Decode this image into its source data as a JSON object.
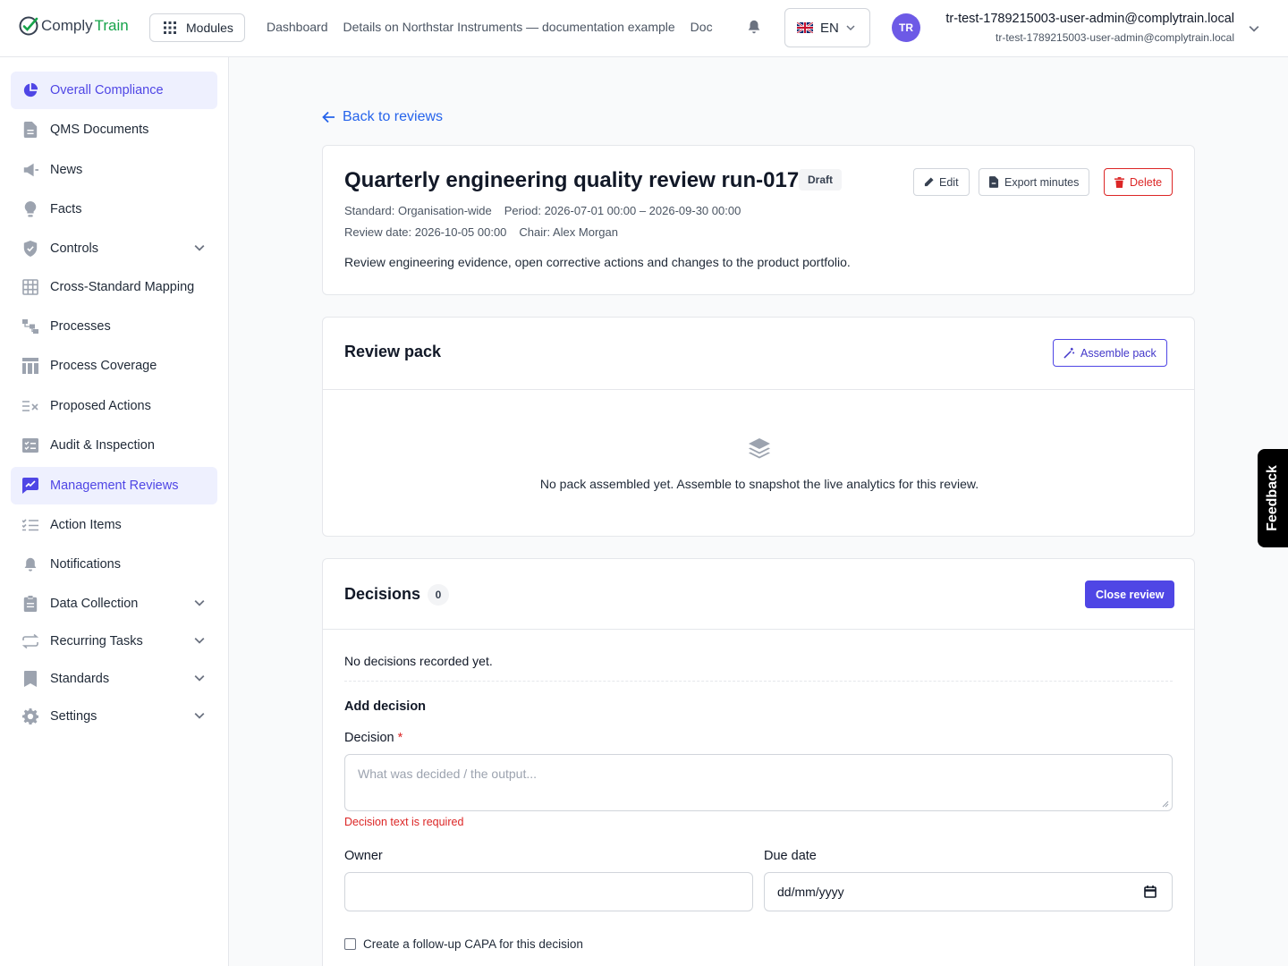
{
  "app": {
    "brand_part1": "Comply",
    "brand_part2": "Train",
    "modules_label": "Modules",
    "nav": [
      "Dashboard",
      "Details on Northstar Instruments — documentation example",
      "Doc"
    ],
    "language": "EN",
    "user": {
      "initials": "TR",
      "name": "tr-test-1789215003-user-admin@complytrain.local",
      "email": "tr-test-1789215003-user-admin@complytrain.local"
    },
    "feedback_label": "Feedback"
  },
  "sidebar": {
    "items": [
      {
        "label": "Overall Compliance",
        "icon": "pie-chart-icon",
        "active": true
      },
      {
        "label": "QMS Documents",
        "icon": "document-icon"
      },
      {
        "label": "News",
        "icon": "megaphone-icon"
      },
      {
        "label": "Facts",
        "icon": "lightbulb-icon"
      },
      {
        "label": "Controls",
        "icon": "shield-icon",
        "expandable": true
      },
      {
        "label": "Cross-Standard Mapping",
        "icon": "grid-icon"
      },
      {
        "label": "Processes",
        "icon": "hierarchy-icon"
      },
      {
        "label": "Process Coverage",
        "icon": "table-icon"
      },
      {
        "label": "Proposed Actions",
        "icon": "list-check-icon"
      },
      {
        "label": "Audit & Inspection",
        "icon": "checklist-icon"
      },
      {
        "label": "Management Reviews",
        "icon": "chart-box-icon",
        "active": true
      },
      {
        "label": "Action Items",
        "icon": "task-list-icon"
      },
      {
        "label": "Notifications",
        "icon": "bell-icon"
      },
      {
        "label": "Data Collection",
        "icon": "clipboard-icon",
        "expandable": true
      },
      {
        "label": "Recurring Tasks",
        "icon": "repeat-icon",
        "expandable": true
      },
      {
        "label": "Standards",
        "icon": "bookmark-icon",
        "expandable": true
      },
      {
        "label": "Settings",
        "icon": "gear-icon",
        "expandable": true
      }
    ]
  },
  "review": {
    "back_label": "Back to reviews",
    "title": "Quarterly engineering quality review run-017",
    "status": "Draft",
    "standard": "Standard: Organisation-wide",
    "period": "Period: 2026-07-01 00:00 – 2026-09-30 00:00",
    "review_date": "Review date: 2026-10-05 00:00",
    "chair": "Chair: Alex Morgan",
    "description": "Review engineering evidence, open corrective actions and changes to the product portfolio.",
    "edit_label": "Edit",
    "export_label": "Export minutes",
    "delete_label": "Delete"
  },
  "pack": {
    "title": "Review pack",
    "assemble_label": "Assemble pack",
    "empty_text": "No pack assembled yet. Assemble to snapshot the live analytics for this review."
  },
  "decisions": {
    "title": "Decisions",
    "count": "0",
    "close_label": "Close review",
    "empty_text": "No decisions recorded yet.",
    "add_title": "Add decision",
    "decision_label": "Decision",
    "required_mark": "*",
    "decision_placeholder": "What was decided / the output...",
    "decision_error": "Decision text is required",
    "owner_label": "Owner",
    "owner_value": "",
    "due_label": "Due date",
    "due_value": "dd/mm/yyyy",
    "capa_label": "Create a follow-up CAPA for this decision"
  }
}
